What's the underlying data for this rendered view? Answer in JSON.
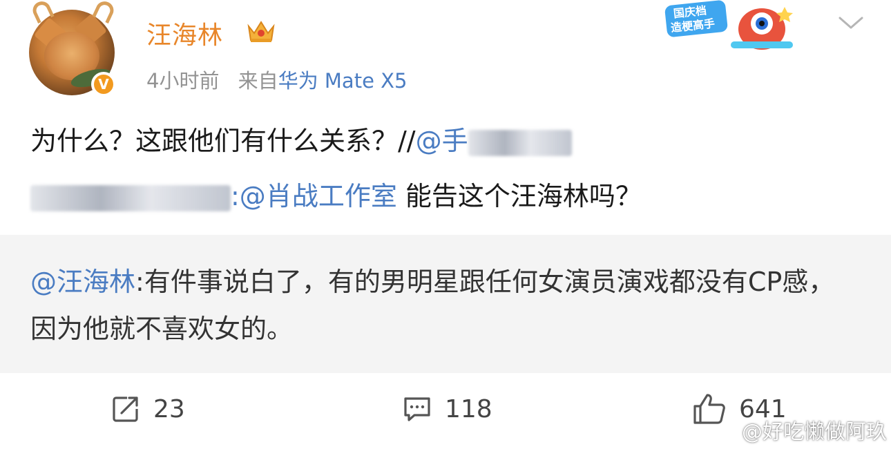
{
  "post": {
    "username": "汪海林",
    "time": "4小时前",
    "from_label": "来自",
    "device": "华为 Mate X5",
    "verified_badge": "V",
    "event_badge_text": "国庆档\n造梗高手",
    "body_line1_text": "为什么？这跟他们有什么关系？//",
    "body_mention1": "@手",
    "body_mention2": ":@肖",
    "body_mention2_rest": "战工作室",
    "body_line2_tail": " 能告这个汪海林吗？"
  },
  "retweet": {
    "mention": "@汪海林",
    "text": ":有件事说白了，有的男明星跟任何女演员演戏都没有CP感，因为他就不喜欢女的。"
  },
  "actions": {
    "repost_count": "23",
    "comment_count": "118",
    "like_count": "641"
  },
  "watermark": {
    "text": "@好吃懒做阿玖"
  },
  "icons": {
    "avatar": "cat-avatar",
    "crown": "crown-icon",
    "more": "chevron-down-icon",
    "repost": "repost-icon",
    "comment": "comment-icon",
    "like": "thumbs-up-icon",
    "weibo": "weibo-logo"
  },
  "colors": {
    "username": "#e8862a",
    "link": "#4a7cc2",
    "meta": "#939393",
    "retweet_bg": "#f4f4f4",
    "verified": "#f29a1f"
  }
}
